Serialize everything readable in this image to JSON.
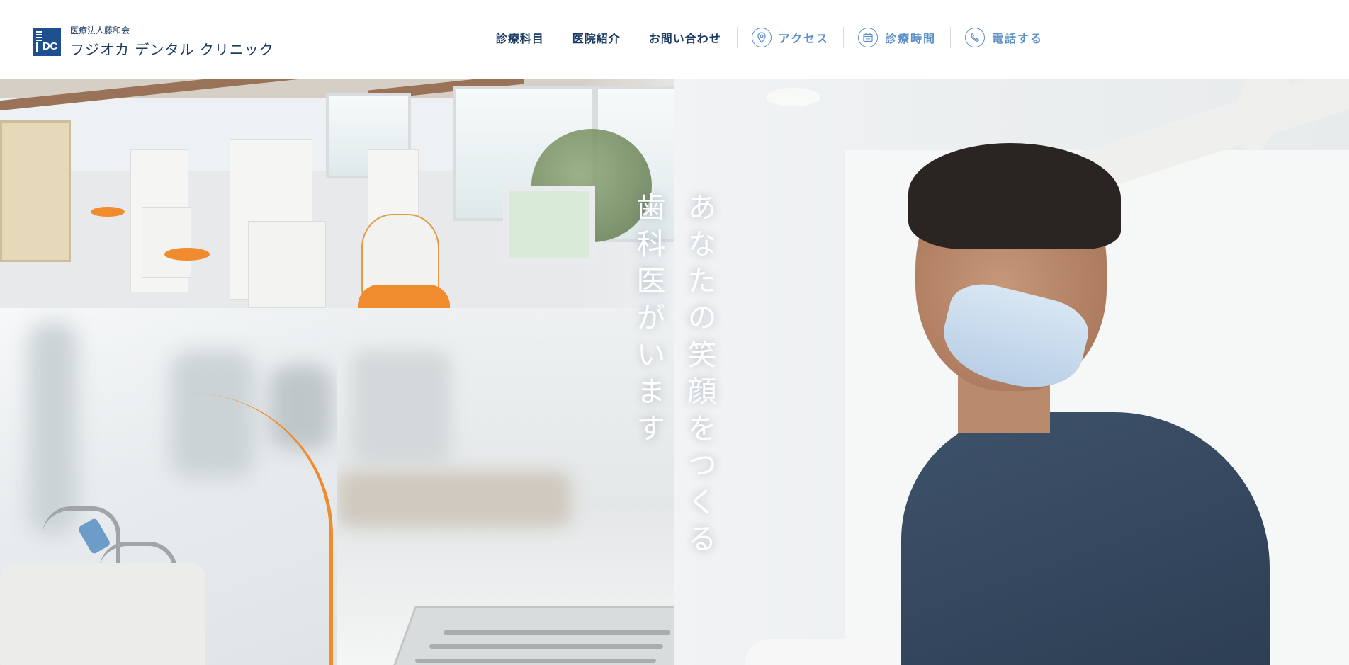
{
  "header": {
    "logo_sub": "医療法人藤和会",
    "logo_name": "フジオカ デンタル クリニック",
    "logo_mark_letters": "DC"
  },
  "nav": {
    "items": [
      {
        "label": "診療科目"
      },
      {
        "label": "医院紹介"
      },
      {
        "label": "お問い合わせ"
      }
    ],
    "utility": [
      {
        "label": "アクセス",
        "icon": "map-pin-icon"
      },
      {
        "label": "診療時間",
        "icon": "calendar-icon"
      },
      {
        "label": "電話する",
        "icon": "phone-icon"
      }
    ],
    "accent_color": "#5b8fc8",
    "text_color": "#1c3b63"
  },
  "hero": {
    "catch_line_1": "あなたの笑顔をつくる",
    "catch_line_2": "歯科医がいます",
    "brand_color": "#1e4f8f"
  }
}
